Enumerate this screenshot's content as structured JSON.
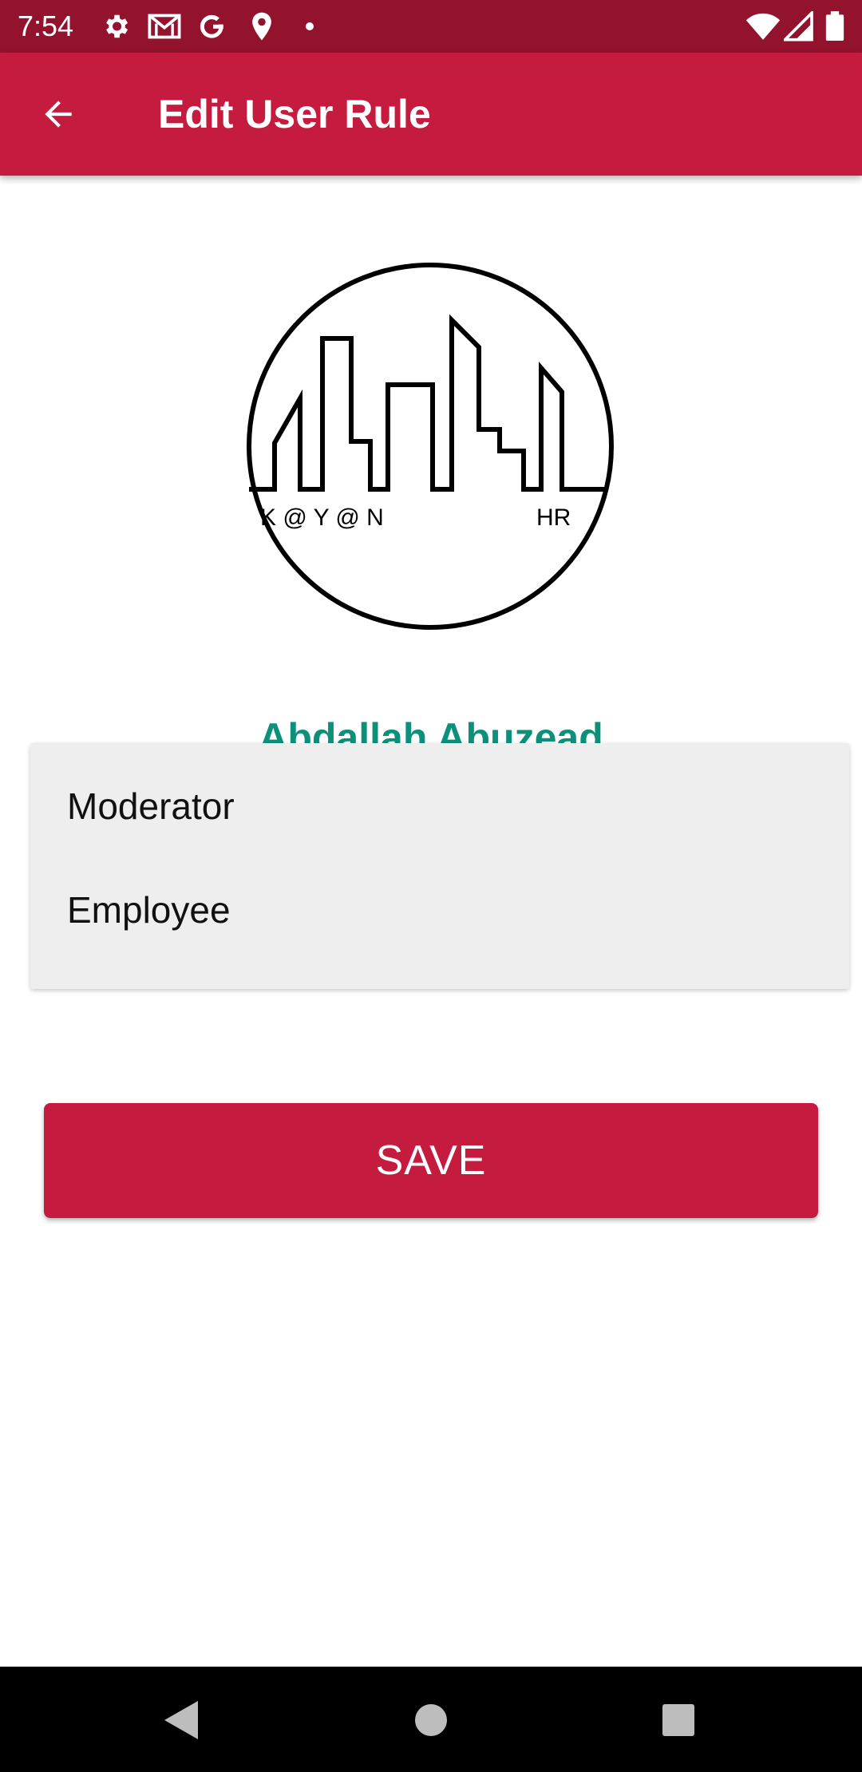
{
  "status_bar": {
    "time": "7:54",
    "left_icons": [
      "gear-icon",
      "gmail-icon",
      "google-icon",
      "location-icon",
      "dot-icon"
    ],
    "right_icons": [
      "wifi-icon",
      "signal-icon",
      "battery-icon"
    ],
    "background": "#93132e"
  },
  "app_bar": {
    "title": "Edit User Rule",
    "back_icon": "arrow-left-icon",
    "background": "#c41b3e"
  },
  "logo": {
    "text_left": "K @ Y @ N",
    "text_right": "HR"
  },
  "user": {
    "name": "Abdallah Abuzead"
  },
  "role_dropdown": {
    "options": [
      "Moderator",
      "Employee"
    ]
  },
  "actions": {
    "save_label": "SAVE"
  },
  "nav_bar": {
    "back_icon": "triangle-back-icon",
    "home_icon": "circle-home-icon",
    "recents_icon": "square-recents-icon"
  },
  "colors": {
    "accent": "#c41b3e",
    "name_text": "#0b9079",
    "dropdown_bg": "#eeeeee"
  }
}
